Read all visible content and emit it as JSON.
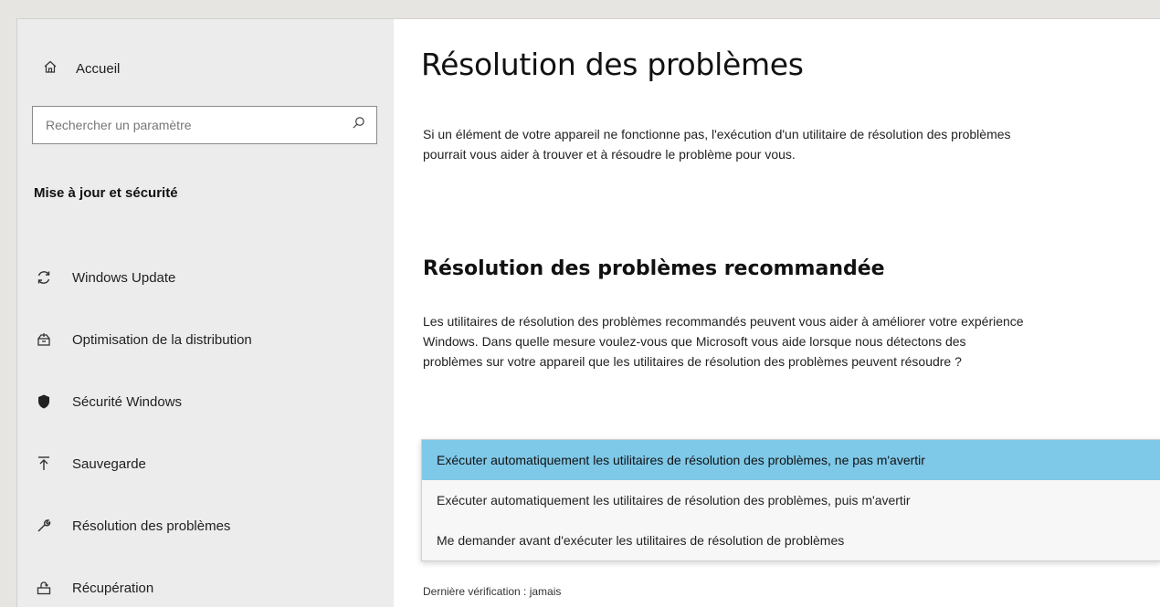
{
  "sidebar": {
    "home_label": "Accueil",
    "search_placeholder": "Rechercher un paramètre",
    "section_title": "Mise à jour et sécurité",
    "items": [
      {
        "label": "Windows Update",
        "icon": "refresh-icon"
      },
      {
        "label": "Optimisation de la distribution",
        "icon": "delivery-optimization-icon"
      },
      {
        "label": "Sécurité Windows",
        "icon": "shield-icon"
      },
      {
        "label": "Sauvegarde",
        "icon": "backup-icon"
      },
      {
        "label": "Résolution des problèmes",
        "icon": "wrench-icon"
      },
      {
        "label": "Récupération",
        "icon": "recovery-icon"
      }
    ]
  },
  "main": {
    "title": "Résolution des problèmes",
    "intro": "Si un élément de votre appareil ne fonctionne pas, l'exécution d'un utilitaire de résolution des problèmes pourrait vous aider à trouver et à résoudre le problème pour vous.",
    "subtitle": "Résolution des problèmes recommandée",
    "description": "Les utilitaires de résolution des problèmes recommandés peuvent vous aider à améliorer votre expérience Windows. Dans quelle mesure voulez-vous que Microsoft vous aide lorsque nous détectons des problèmes sur votre appareil que les utilitaires de résolution des problèmes peuvent résoudre ?",
    "dropdown": {
      "options": [
        "Exécuter automatiquement les utilitaires de résolution des problèmes, ne pas m'avertir",
        "Exécuter automatiquement les utilitaires de résolution des problèmes, puis m'avertir",
        "Me demander avant d'exécuter les utilitaires de résolution de problèmes"
      ],
      "selected_index": 0
    },
    "last_check": "Dernière vérification : jamais"
  },
  "colors": {
    "sidebar_bg": "#ececec",
    "selected_option_bg": "#7ec8e8"
  }
}
